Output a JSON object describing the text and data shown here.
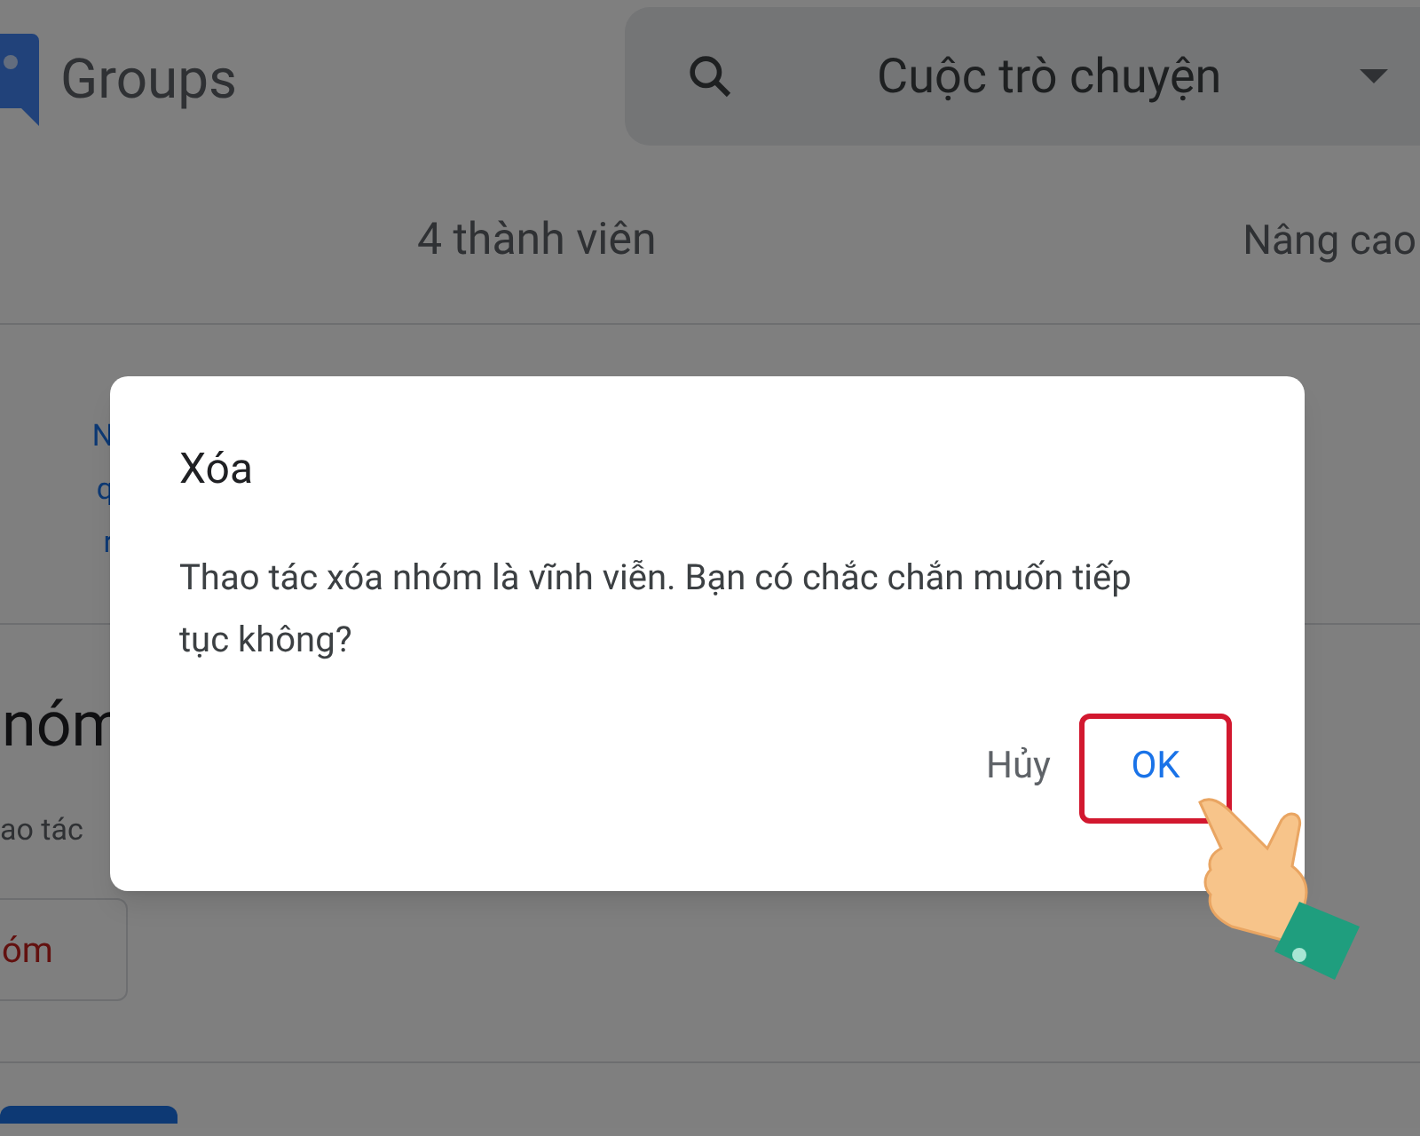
{
  "header": {
    "app_name": "Groups",
    "search": {
      "value": "Cuộc trò chuyện"
    }
  },
  "tabs": [
    {
      "label": "4 thành viên"
    },
    {
      "label": "Nâng cao"
    }
  ],
  "links": [
    "N",
    "q",
    "r"
  ],
  "section": {
    "title": "nóm",
    "description": "ao tác",
    "button": "óm"
  },
  "dialog": {
    "title": "Xóa",
    "message": "Thao tác xóa nhóm là vĩnh viễn. Bạn có chắc chắn muốn tiếp tục không?",
    "buttons": [
      {
        "label": "Hủy",
        "highlighted": false
      },
      {
        "label": "OK",
        "highlighted": true
      }
    ]
  }
}
